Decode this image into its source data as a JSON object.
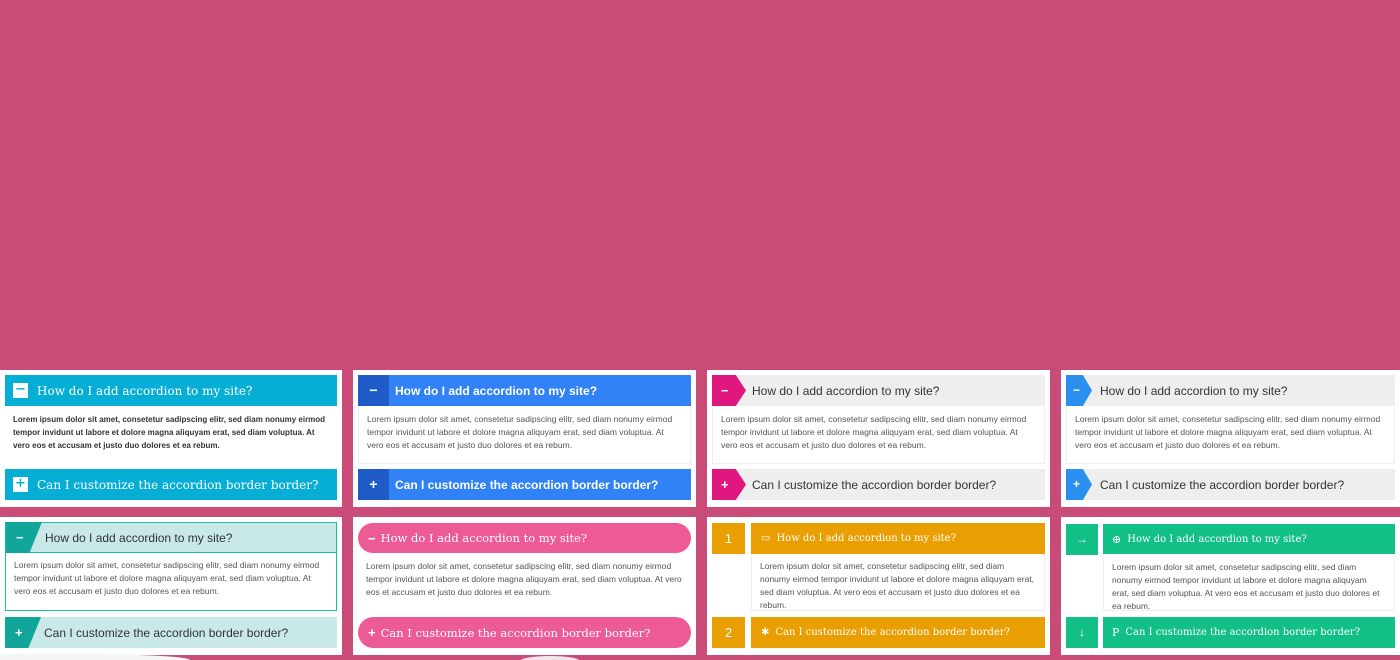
{
  "q1": "How do I add accordion to my site?",
  "q2": "Can I customize the accordion border border?",
  "answer": "Lorem ipsum dolor sit amet, consetetur sadipscing elitr, sed diam nonumy eirmod tempor invidunt ut labore et dolore magna aliquyam erat, sed diam voluptua. At vero eos et accusam et justo duo dolores et ea rebum.",
  "icons": {
    "minus": "−",
    "plus": "+",
    "num1": "1",
    "num2": "2",
    "arrow_right": "→",
    "arrow_down": "↓",
    "laptop": "▭",
    "gear": "✱",
    "globe": "⊕",
    "paypal": "P"
  },
  "colors": {
    "background": "#c94b78",
    "style1": "#06aed5",
    "style2": "#3182f6",
    "style3": "#e0177f",
    "style4": "#2b8ff0",
    "style5": "#12a59a",
    "style6": "#ed5b96",
    "style7": "#e99e01",
    "style8": "#12bf87"
  }
}
